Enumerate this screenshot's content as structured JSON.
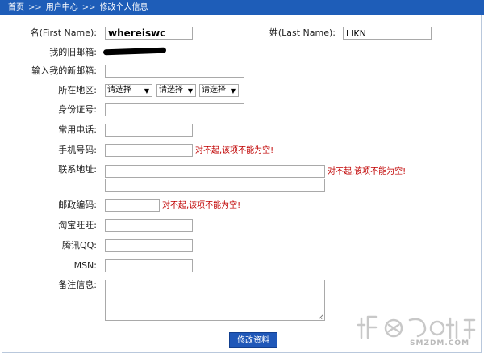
{
  "breadcrumb": {
    "home": "首页",
    "separator": ">>",
    "user_center": "用户中心",
    "current": "修改个人信息"
  },
  "fields": {
    "first_name": {
      "label": "名(First Name):",
      "value": "whereiswc"
    },
    "last_name": {
      "label": "姓(Last Name):",
      "value": "LIKN"
    },
    "old_email": {
      "label": "我的旧邮箱:"
    },
    "new_email": {
      "label": "输入我的新邮箱:",
      "value": ""
    },
    "region": {
      "label": "所在地区:",
      "selects": [
        "请选择",
        "请选择",
        "请选择"
      ]
    },
    "id_number": {
      "label": "身份证号:",
      "value": ""
    },
    "phone": {
      "label": "常用电话:",
      "value": ""
    },
    "mobile": {
      "label": "手机号码:",
      "value": "",
      "error": "对不起,该项不能为空!"
    },
    "address": {
      "label": "联系地址:",
      "value": "",
      "error": "对不起,该项不能为空!"
    },
    "postcode": {
      "label": "邮政编码:",
      "value": "",
      "error": "对不起,该项不能为空!"
    },
    "taobao": {
      "label": "淘宝旺旺:",
      "value": ""
    },
    "qq": {
      "label": "腾讯QQ:",
      "value": ""
    },
    "msn": {
      "label": "MSN:",
      "value": ""
    },
    "notes": {
      "label": "备注信息:",
      "value": ""
    }
  },
  "submit_label": "修改资料",
  "watermark": {
    "text": "SMZDM.COM"
  },
  "colors": {
    "header": "#1e5db8",
    "error": "#c00000",
    "button": "#1f57b8"
  }
}
